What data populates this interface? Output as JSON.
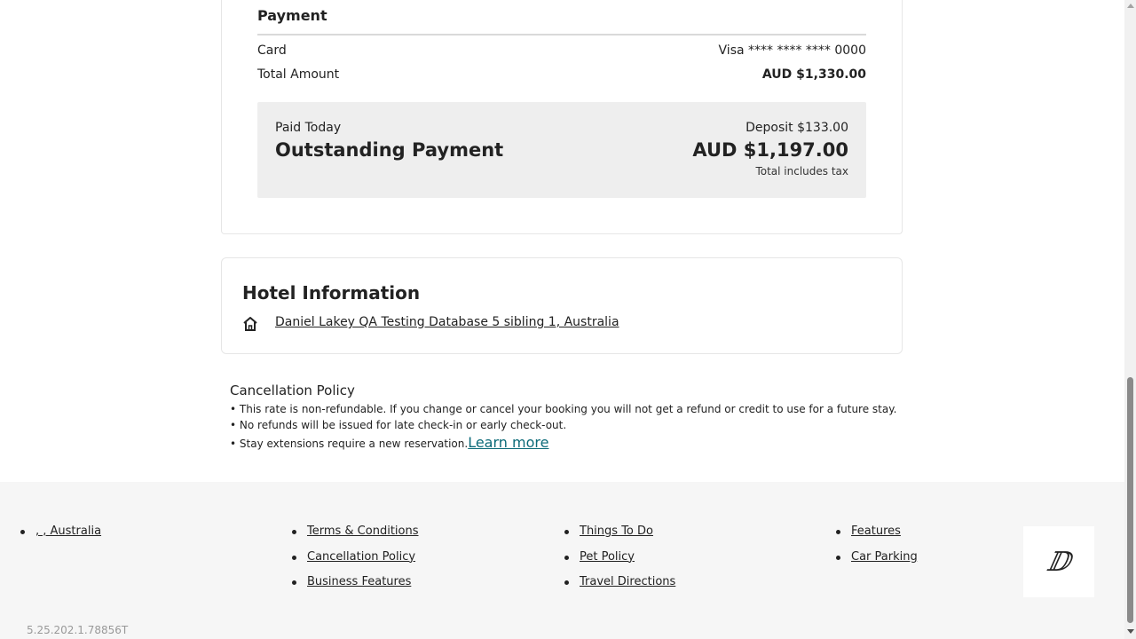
{
  "payment": {
    "heading": "Payment",
    "card_label": "Card",
    "card_value": "Visa **** **** **** 0000",
    "total_label": "Total Amount",
    "total_value": "AUD $1,330.00",
    "paid_today_label": "Paid Today",
    "deposit_label": "Deposit $133.00",
    "outstanding_label": "Outstanding Payment",
    "outstanding_amount": "AUD $1,197.00",
    "tax_note": "Total includes tax"
  },
  "hotel": {
    "title": "Hotel Information",
    "address_icon": "home-icon",
    "address_link": "Daniel Lakey QA Testing Database 5 sibling 1, Australia"
  },
  "cancellation": {
    "title": "Cancellation Policy",
    "lines": [
      "• This rate is non-refundable. If you change or cancel your booking you will not get a refund or credit to use for a future stay.",
      "• No refunds will be issued for late check-in or early check-out.",
      "• Stay extensions require a new reservation."
    ],
    "learn_more": "Learn more"
  },
  "footer": {
    "col1": [
      ", , Australia"
    ],
    "col2": [
      "Terms & Conditions",
      "Cancellation Policy",
      "Business Features"
    ],
    "col3": [
      "Things To Do",
      "Pet Policy",
      "Travel Directions"
    ],
    "col4": [
      "Features",
      "Car Parking"
    ],
    "logo_text": "ⅅ",
    "version": "5.25.202.1.78856T"
  },
  "colors": {
    "link_accent": "#0b6a78",
    "footer_bg": "#f6f6f6",
    "box_bg": "#eeeeee"
  }
}
